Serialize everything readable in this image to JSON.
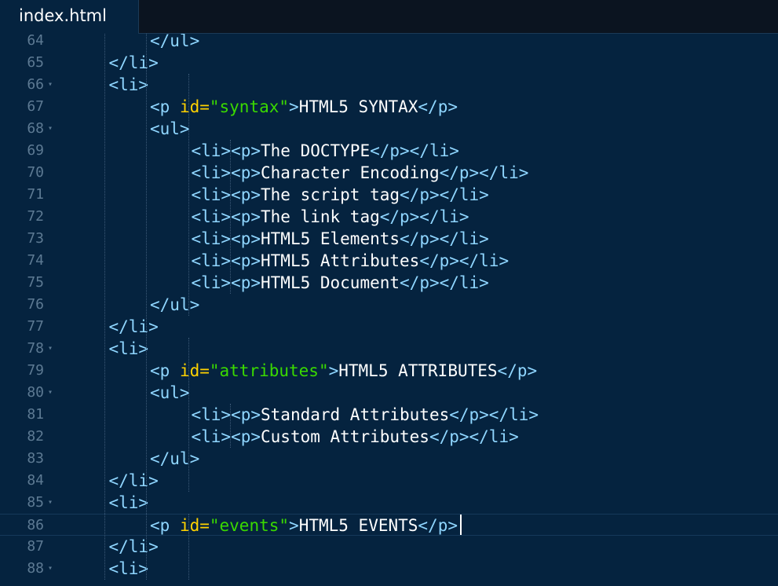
{
  "tab": {
    "title": "index.html"
  },
  "colors": {
    "background": "#05233f",
    "tag": "#8fd6ff",
    "attribute": "#ffd200",
    "string": "#3ad900",
    "text": "#ffffff",
    "line_number": "#5d7a93"
  },
  "editor": {
    "active_line": 86,
    "lines": [
      {
        "num": "64",
        "fold": false,
        "tokens": [
          [
            "tag",
            "</ul>"
          ]
        ]
      },
      {
        "num": "65",
        "fold": false,
        "tokens": [
          [
            "tag",
            "</li>"
          ]
        ]
      },
      {
        "num": "66",
        "fold": true,
        "tokens": [
          [
            "tag",
            "<li>"
          ]
        ]
      },
      {
        "num": "67",
        "fold": false,
        "tokens": [
          [
            "tag",
            "<p "
          ],
          [
            "attr",
            "id="
          ],
          [
            "str",
            "\"syntax\""
          ],
          [
            "tag",
            ">"
          ],
          [
            "txt",
            "HTML5 SYNTAX"
          ],
          [
            "tag",
            "</p>"
          ]
        ]
      },
      {
        "num": "68",
        "fold": true,
        "tokens": [
          [
            "tag",
            "<ul>"
          ]
        ]
      },
      {
        "num": "69",
        "fold": false,
        "tokens": [
          [
            "tag",
            "<li><p>"
          ],
          [
            "txt",
            "The DOCTYPE"
          ],
          [
            "tag",
            "</p></li>"
          ]
        ]
      },
      {
        "num": "70",
        "fold": false,
        "tokens": [
          [
            "tag",
            "<li><p>"
          ],
          [
            "txt",
            "Character Encoding"
          ],
          [
            "tag",
            "</p></li>"
          ]
        ]
      },
      {
        "num": "71",
        "fold": false,
        "tokens": [
          [
            "tag",
            "<li><p>"
          ],
          [
            "txt",
            "The script tag"
          ],
          [
            "tag",
            "</p></li>"
          ]
        ]
      },
      {
        "num": "72",
        "fold": false,
        "tokens": [
          [
            "tag",
            "<li><p>"
          ],
          [
            "txt",
            "The link tag"
          ],
          [
            "tag",
            "</p></li>"
          ]
        ]
      },
      {
        "num": "73",
        "fold": false,
        "tokens": [
          [
            "tag",
            "<li><p>"
          ],
          [
            "txt",
            "HTML5 Elements"
          ],
          [
            "tag",
            "</p></li>"
          ]
        ]
      },
      {
        "num": "74",
        "fold": false,
        "tokens": [
          [
            "tag",
            "<li><p>"
          ],
          [
            "txt",
            "HTML5 Attributes"
          ],
          [
            "tag",
            "</p></li>"
          ]
        ]
      },
      {
        "num": "75",
        "fold": false,
        "tokens": [
          [
            "tag",
            "<li><p>"
          ],
          [
            "txt",
            "HTML5 Document"
          ],
          [
            "tag",
            "</p></li>"
          ]
        ]
      },
      {
        "num": "76",
        "fold": false,
        "tokens": [
          [
            "tag",
            "</ul>"
          ]
        ]
      },
      {
        "num": "77",
        "fold": false,
        "tokens": [
          [
            "tag",
            "</li>"
          ]
        ]
      },
      {
        "num": "78",
        "fold": true,
        "tokens": [
          [
            "tag",
            "<li>"
          ]
        ]
      },
      {
        "num": "79",
        "fold": false,
        "tokens": [
          [
            "tag",
            "<p "
          ],
          [
            "attr",
            "id="
          ],
          [
            "str",
            "\"attributes\""
          ],
          [
            "tag",
            ">"
          ],
          [
            "txt",
            "HTML5 ATTRIBUTES"
          ],
          [
            "tag",
            "</p>"
          ]
        ]
      },
      {
        "num": "80",
        "fold": true,
        "tokens": [
          [
            "tag",
            "<ul>"
          ]
        ]
      },
      {
        "num": "81",
        "fold": false,
        "tokens": [
          [
            "tag",
            "<li><p>"
          ],
          [
            "txt",
            "Standard Attributes"
          ],
          [
            "tag",
            "</p></li>"
          ]
        ]
      },
      {
        "num": "82",
        "fold": false,
        "tokens": [
          [
            "tag",
            "<li><p>"
          ],
          [
            "txt",
            "Custom Attributes"
          ],
          [
            "tag",
            "</p></li>"
          ]
        ]
      },
      {
        "num": "83",
        "fold": false,
        "tokens": [
          [
            "tag",
            "</ul>"
          ]
        ]
      },
      {
        "num": "84",
        "fold": false,
        "tokens": [
          [
            "tag",
            "</li>"
          ]
        ]
      },
      {
        "num": "85",
        "fold": true,
        "tokens": [
          [
            "tag",
            "<li>"
          ]
        ]
      },
      {
        "num": "86",
        "fold": false,
        "tokens": [
          [
            "tag",
            "<p "
          ],
          [
            "attr",
            "id="
          ],
          [
            "str",
            "\"events\""
          ],
          [
            "tag",
            ">"
          ],
          [
            "txt",
            "HTML5 EVENTS"
          ],
          [
            "tag",
            "</p>"
          ]
        ]
      },
      {
        "num": "87",
        "fold": false,
        "tokens": [
          [
            "tag",
            "</li>"
          ]
        ]
      },
      {
        "num": "88",
        "fold": true,
        "tokens": [
          [
            "tag",
            "<li>"
          ]
        ]
      }
    ]
  }
}
